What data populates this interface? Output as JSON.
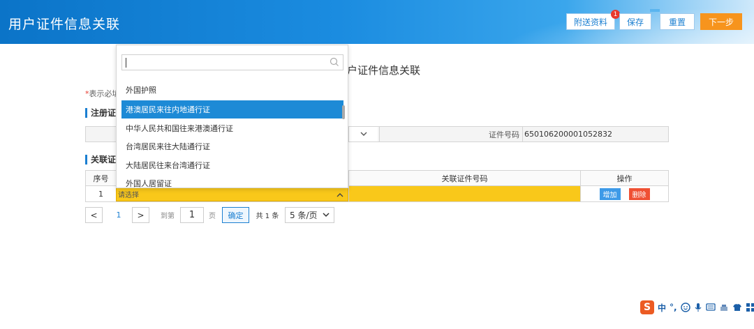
{
  "header": {
    "title": "用户证件信息关联",
    "buttons": {
      "attach": "附送资料",
      "save": "保存",
      "reset": "重置",
      "next": "下一步"
    },
    "attach_badge": "1"
  },
  "form": {
    "title": "户证件信息关联",
    "required_note_star": "*",
    "required_note": "表示必填",
    "section_registered": "注册证件",
    "section_related": "关联证件",
    "cert_number_label": "证件号码",
    "cert_number_value": "650106200001052832"
  },
  "table": {
    "headers": {
      "index": "序号",
      "related_number": "关联证件号码",
      "operation": "操作"
    },
    "rows": [
      {
        "index": "1",
        "select_placeholder": "请选择"
      }
    ],
    "add_label": "增加",
    "delete_label": "删除"
  },
  "pager": {
    "prev": "<",
    "current": "1",
    "next": ">",
    "goto_label": "到第",
    "goto_value": "1",
    "page_label": "页",
    "confirm": "确定",
    "total": "共 1 条",
    "page_size": "5 条/页"
  },
  "dropdown": {
    "search_value": "",
    "items": [
      {
        "label": "外国护照",
        "selected": false
      },
      {
        "label": "港澳居民来往内地通行证",
        "selected": true
      },
      {
        "label": "中华人民共和国往来港澳通行证",
        "selected": false
      },
      {
        "label": "台湾居民来往大陆通行证",
        "selected": false
      },
      {
        "label": "大陆居民往来台湾通行证",
        "selected": false
      },
      {
        "label": "外国人居留证",
        "selected": false
      }
    ]
  },
  "ime": {
    "logo": "S",
    "mode": "中",
    "punct": "°,"
  },
  "colors": {
    "header_blue": "#0b74c8",
    "next_orange": "#f7941d",
    "selected_blue": "#1d8ad6",
    "highlight_yellow": "#f9c81a",
    "delete_red": "#ef5033"
  }
}
